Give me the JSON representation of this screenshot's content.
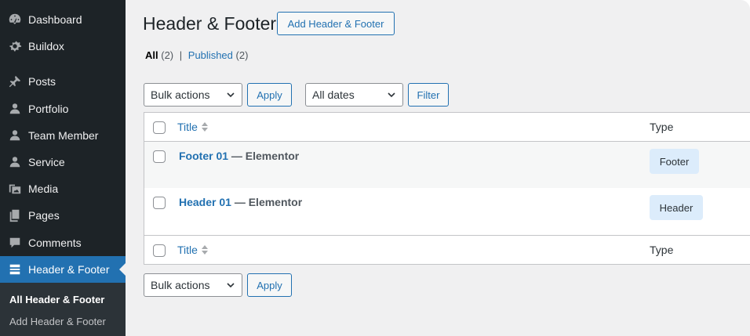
{
  "sidebar": {
    "items": [
      {
        "label": "Dashboard",
        "icon": "dashboard-icon"
      },
      {
        "label": "Buildox",
        "icon": "gear-icon"
      },
      {
        "label": "Posts",
        "icon": "pin-icon"
      },
      {
        "label": "Portfolio",
        "icon": "user-icon"
      },
      {
        "label": "Team Member",
        "icon": "user-icon"
      },
      {
        "label": "Service",
        "icon": "user-icon"
      },
      {
        "label": "Media",
        "icon": "media-icon"
      },
      {
        "label": "Pages",
        "icon": "pages-icon"
      },
      {
        "label": "Comments",
        "icon": "comment-icon"
      },
      {
        "label": "Header & Footer",
        "icon": "header-footer-icon"
      }
    ],
    "submenu": [
      {
        "label": "All Header & Footer"
      },
      {
        "label": "Add Header & Footer"
      }
    ]
  },
  "page": {
    "title": "Header & Footer",
    "add_button": "Add Header & Footer"
  },
  "filters": {
    "all_label": "All",
    "all_count": "(2)",
    "separator": "|",
    "published_label": "Published",
    "published_count": "(2)"
  },
  "toolbar": {
    "bulk_actions": "Bulk actions",
    "apply": "Apply",
    "dates": "All dates",
    "filter": "Filter"
  },
  "table": {
    "col_title": "Title",
    "col_type": "Type",
    "rows": [
      {
        "title": "Footer 01",
        "suffix": " — Elementor",
        "type": "Footer"
      },
      {
        "title": "Header 01",
        "suffix": " — Elementor",
        "type": "Header"
      }
    ]
  },
  "colors": {
    "sidebar_bg": "#1d2327",
    "accent": "#2271b1",
    "content_bg": "#f0f0f1",
    "badge_bg": "#dcecfb"
  }
}
